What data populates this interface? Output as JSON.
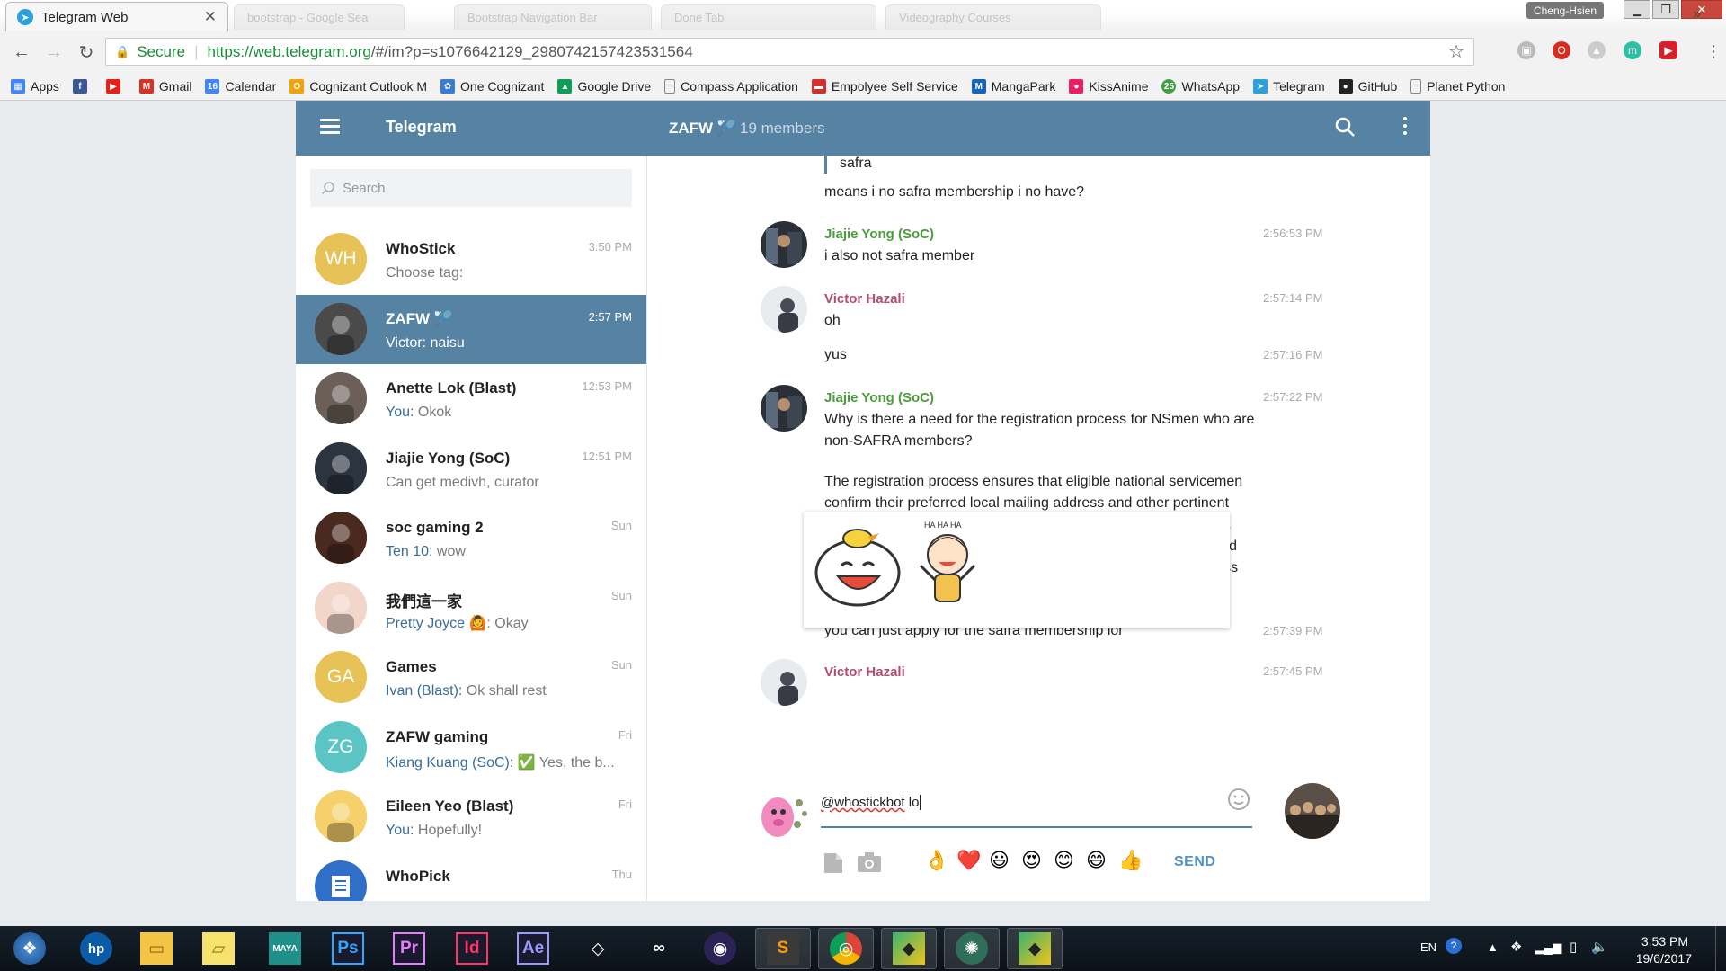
{
  "browser": {
    "active_tab": {
      "title": "Telegram Web"
    },
    "inactive_tabs": [
      "bootstrap - Google Sea",
      "Bootstrap Navigation Bar",
      "Done Tab",
      "Videography Courses"
    ],
    "profile_name": "Cheng-Hsien",
    "address": {
      "secure_label": "Secure",
      "url_host": "https://web.telegram.org",
      "url_path": "/#/im?p=s1076642129_2980742157423531564"
    },
    "bookmarks": [
      {
        "label": "Apps",
        "icon": "apps-grid-icon",
        "color": "#4285f4"
      },
      {
        "label": "",
        "icon": "facebook-icon",
        "color": "#3b5998"
      },
      {
        "label": "",
        "icon": "youtube-icon",
        "color": "#e62117"
      },
      {
        "label": "Gmail",
        "icon": "gmail-icon",
        "color": "#d93025"
      },
      {
        "label": "Calendar",
        "icon": "calendar-icon",
        "color": "#4285f4"
      },
      {
        "label": "Cognizant Outlook M",
        "icon": "outlook-icon",
        "color": "#f0a30a"
      },
      {
        "label": "One Cognizant",
        "icon": "one-cognizant-icon",
        "color": "#3a7bd5"
      },
      {
        "label": "Google Drive",
        "icon": "google-drive-icon",
        "color": "#0f9d58"
      },
      {
        "label": "Compass Application",
        "icon": "page-icon",
        "color": "#888888"
      },
      {
        "label": "Empolyee Self Service",
        "icon": "ess-icon",
        "color": "#d32f2f"
      },
      {
        "label": "MangaPark",
        "icon": "mangapark-icon",
        "color": "#1565c0"
      },
      {
        "label": "KissAnime",
        "icon": "kissanime-icon",
        "color": "#e91e63"
      },
      {
        "label": "WhatsApp",
        "icon": "whatsapp-icon",
        "color": "#43a047"
      },
      {
        "label": "Telegram",
        "icon": "telegram-icon",
        "color": "#2aa1da"
      },
      {
        "label": "GitHub",
        "icon": "github-icon",
        "color": "#222222"
      },
      {
        "label": "Planet Python",
        "icon": "page-icon",
        "color": "#888888"
      }
    ],
    "bookmark_calendar_day": "16",
    "whatsapp_badge": "25"
  },
  "telegram": {
    "app_title": "Telegram",
    "chat_title": "ZAFW",
    "chat_members": "19 members",
    "search_placeholder": "Search",
    "dialogs": [
      {
        "name": "WhoStick",
        "time": "3:50 PM",
        "from": "",
        "message": "Choose tag:",
        "initials": "WH",
        "avatar_color": "#e6c257",
        "active": false
      },
      {
        "name": "ZAFW",
        "time": "2:57 PM",
        "from": "",
        "message": "Victor: naisu",
        "initials": "",
        "avatar_color": "#4a4a4a",
        "active": true
      },
      {
        "name": "Anette Lok (Blast)",
        "time": "12:53 PM",
        "from": "You:",
        "message": " Okok",
        "initials": "",
        "avatar_color": "#6b5f58",
        "active": false
      },
      {
        "name": "Jiajie Yong (SoC)",
        "time": "12:51 PM",
        "from": "",
        "message": "Can get medivh, curator",
        "initials": "",
        "avatar_color": "#2c3440",
        "active": false
      },
      {
        "name": "soc gaming 2",
        "time": "Sun",
        "from": "Ten 10:",
        "message": " wow",
        "initials": "",
        "avatar_color": "#4a2a20",
        "active": false
      },
      {
        "name": "我們這一家",
        "time": "Sun",
        "from": "Pretty Joyce",
        "message": ": Okay",
        "initials": "",
        "avatar_color": "#f1d6c9",
        "active": false
      },
      {
        "name": "Games",
        "time": "Sun",
        "from": "Ivan (Blast):",
        "message": " Ok shall rest",
        "initials": "GA",
        "avatar_color": "#e6c257",
        "active": false
      },
      {
        "name": "ZAFW gaming",
        "time": "Fri",
        "from": "Kiang Kuang (SoC):",
        "message": " ✅ Yes, the b...",
        "initials": "ZG",
        "avatar_color": "#5bc4c4",
        "active": false
      },
      {
        "name": "Eileen Yeo (Blast)",
        "time": "Fri",
        "from": "You:",
        "message": " Hopefully!",
        "initials": "",
        "avatar_color": "#f5d06b",
        "active": false
      },
      {
        "name": "WhoPick",
        "time": "Thu",
        "from": "",
        "message": "",
        "initials": "",
        "avatar_color": "#2f6fc7",
        "active": false
      }
    ],
    "messages": {
      "quote_text": "safra",
      "line1": "means i no safra membership i no have?",
      "m1": {
        "author": "Jiajie Yong (SoC)",
        "time": "2:56:53 PM",
        "text": "i also not safra member"
      },
      "m2": {
        "author": "Victor Hazali",
        "time": "2:57:14 PM",
        "text": "oh"
      },
      "m3": {
        "time": "2:57:16 PM",
        "text": "yus"
      },
      "m4": {
        "author": "Jiajie Yong (SoC)",
        "time": "2:57:22 PM",
        "p1": "Why is there a need for the registration process for NSmen who are non-SAFRA members?",
        "p2": "The registration process ensures that eligible national servicemen confirm their preferred local mailing address and other pertinent details before the NS50 Recognition Package is mailed to them. This ensures that the Recognition Package reaches the intended recipient and is administered accurately. The registration process can be completed in a few simple steps."
      },
      "m5": {
        "time": "2:57:39 PM",
        "text": "you can just apply for the safra membership lor"
      },
      "m6": {
        "author": "Victor Hazali",
        "time": "2:57:45 PM"
      }
    },
    "composer": {
      "mention": "@whostickbot",
      "rest": " lo",
      "send_label": "SEND",
      "quick_emojis": [
        "👌",
        "❤️",
        "😃",
        "😍",
        "😊",
        "😄",
        "👍"
      ]
    },
    "colors": {
      "header": "#5682a3",
      "author_green": "#4a9d3a",
      "author_red": "#b34e6d"
    }
  },
  "taskbar": {
    "apps": [
      {
        "icon": "windows-start-icon"
      },
      {
        "icon": "hp-icon"
      },
      {
        "icon": "file-explorer-icon"
      },
      {
        "icon": "sticky-notes-icon"
      },
      {
        "icon": "maya-icon",
        "label": "MAYA"
      },
      {
        "icon": "photoshop-icon",
        "label": "Ps",
        "color": "#31a8ff"
      },
      {
        "icon": "premiere-icon",
        "label": "Pr",
        "color": "#e77cff"
      },
      {
        "icon": "indesign-icon",
        "label": "Id",
        "color": "#ff3366"
      },
      {
        "icon": "after-effects-icon",
        "label": "Ae",
        "color": "#9999ff"
      },
      {
        "icon": "unity-icon"
      },
      {
        "icon": "infinity-icon"
      },
      {
        "icon": "eclipse-icon"
      },
      {
        "icon": "sublime-text-icon",
        "label": "S"
      },
      {
        "icon": "chrome-icon"
      },
      {
        "icon": "sourcetree-icon"
      },
      {
        "icon": "anaconda-icon"
      },
      {
        "icon": "gitkraken-icon"
      }
    ],
    "tray_language": "EN",
    "time": "3:53 PM",
    "date": "19/6/2017"
  }
}
